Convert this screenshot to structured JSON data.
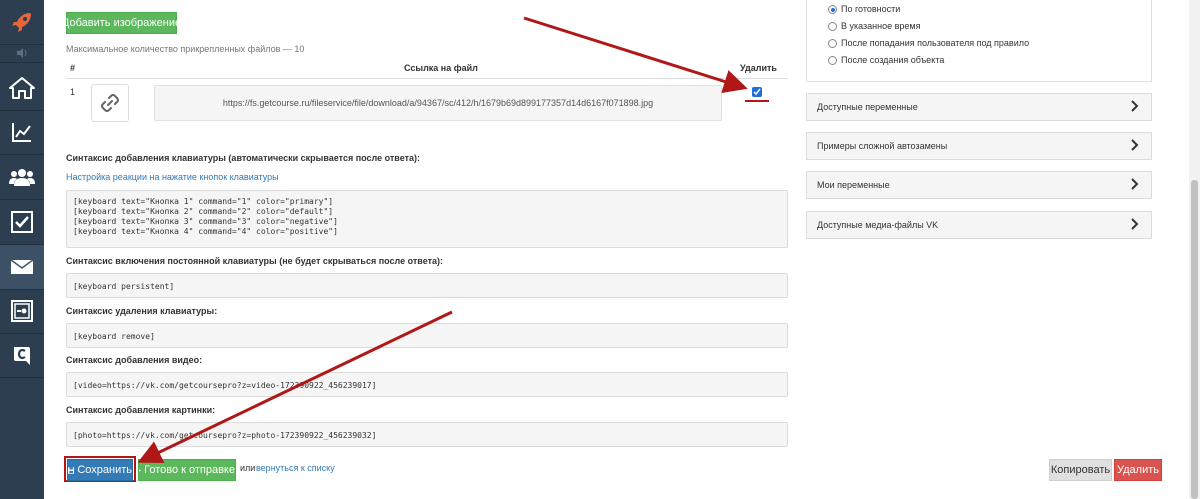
{
  "sidebar": {
    "items": [
      {
        "name": "rocket-icon"
      },
      {
        "name": "speaker-icon"
      },
      {
        "name": "home-icon"
      },
      {
        "name": "chart-icon"
      },
      {
        "name": "users-icon"
      },
      {
        "name": "tasks-icon"
      },
      {
        "name": "mail-icon"
      },
      {
        "name": "safe-icon"
      },
      {
        "name": "getcourse-logo-icon"
      }
    ]
  },
  "attachments": {
    "add_button": "Добавить изображение",
    "max_files_note": "Максимальное количество прикрепленных файлов — 10",
    "col_number": "#",
    "col_link": "Ссылка на файл",
    "col_delete": "Удалить",
    "rows": [
      {
        "num": "1",
        "url": "https://fs.getcourse.ru/fileservice/file/download/a/94367/sc/412/h/1679b69d899177357d14d6167f071898.jpg",
        "delete_checked": true
      }
    ]
  },
  "keyboard": {
    "heading": "Синтаксис добавления клавиатуры (автоматически скрывается после ответа):",
    "settings_link": "Настройка реакции на нажатие кнопок клавиатуры",
    "code": "[keyboard text=\"Кнопка 1\" command=\"1\" color=\"primary\"]\n[keyboard text=\"Кнопка 2\" command=\"2\" color=\"default\"]\n[keyboard text=\"Кнопка 3\" command=\"3\" color=\"negative\"]\n[keyboard text=\"Кнопка 4\" command=\"4\" color=\"positive\"]",
    "persistent_heading": "Синтаксис включения постоянной клавиатуры (не будет скрываться после ответа):",
    "persistent_code": "[keyboard persistent]",
    "remove_heading": "Синтаксис удаления клавиатуры:",
    "remove_code": "[keyboard remove]",
    "video_heading": "Синтаксис добавления видео:",
    "video_code": "[video=https://vk.com/getcoursepro?z=video-172390922_456239017]",
    "image_heading": "Синтаксис добавления картинки:",
    "image_code": "[photo=https://vk.com/getcoursepro?z=photo-172390922_456239032]"
  },
  "footer": {
    "save": "Сохранить",
    "ready": "Готово к отправке",
    "or": "или",
    "back_link": "вернуться к списку",
    "copy": "Копировать",
    "delete": "Удалить"
  },
  "send_options": [
    {
      "label": "По готовности",
      "checked": true
    },
    {
      "label": "В указанное время",
      "checked": false
    },
    {
      "label": "После попадания пользователя под правило",
      "checked": false
    },
    {
      "label": "После создания объекта",
      "checked": false
    }
  ],
  "panels": [
    {
      "label": "Доступные переменные"
    },
    {
      "label": "Примеры сложной автозамены"
    },
    {
      "label": "Мои переменные"
    },
    {
      "label": "Доступные медиа-файлы VK"
    }
  ],
  "colors": {
    "sidebar_bg": "#2c3e50",
    "green": "#5cb85c",
    "blue": "#337ab7",
    "red": "#d9534f",
    "annotation_red": "#b01818"
  }
}
